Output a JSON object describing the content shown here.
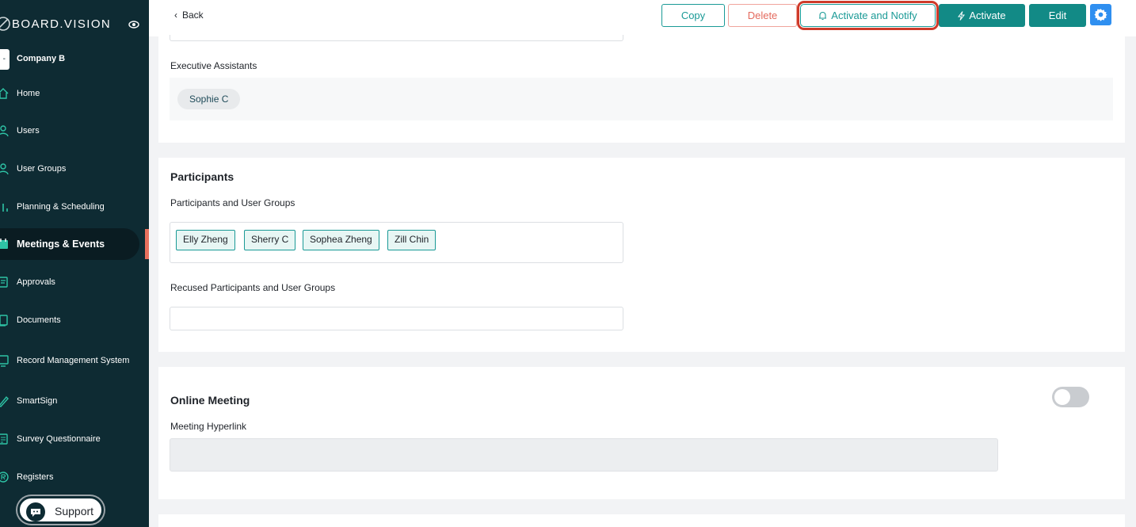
{
  "sidebar": {
    "brand": "BOARD.VISION",
    "company_badge": "-",
    "company": "Company B",
    "items": [
      {
        "label": "Home",
        "icon": "home-icon"
      },
      {
        "label": "Users",
        "icon": "user-icon"
      },
      {
        "label": "User Groups",
        "icon": "user-group-icon"
      },
      {
        "label": "Planning & Scheduling",
        "icon": "chart-icon"
      },
      {
        "label": "Meetings & Events",
        "icon": "calendar-icon"
      },
      {
        "label": "Approvals",
        "icon": "approval-icon"
      },
      {
        "label": "Documents",
        "icon": "documents-icon"
      },
      {
        "label": "Record Management System",
        "icon": "record-icon"
      },
      {
        "label": "SmartSign",
        "icon": "pen-icon"
      },
      {
        "label": "Survey Questionnaire",
        "icon": "survey-icon"
      },
      {
        "label": "Registers",
        "icon": "registers-icon"
      }
    ],
    "active_item": "Meetings & Events",
    "support_label": "Support"
  },
  "topbar": {
    "back_label": "Back",
    "copy_label": "Copy",
    "delete_label": "Delete",
    "notify_label": "Activate and Notify",
    "activate_label": "Activate",
    "edit_label": "Edit"
  },
  "executive_assistants": {
    "label": "Executive Assistants",
    "people": [
      "Sophie C"
    ]
  },
  "participants": {
    "title": "Participants",
    "groups_label": "Participants and User Groups",
    "tags": [
      "Elly Zheng",
      "Sherry C",
      "Sophea Zheng",
      "Zill Chin"
    ],
    "recused_label": "Recused Participants and User Groups",
    "recused_value": ""
  },
  "online_meeting": {
    "title": "Online Meeting",
    "enabled": false,
    "hyperlink_label": "Meeting Hyperlink",
    "hyperlink_value": ""
  },
  "colors": {
    "sidebar_bg": "#0e2b33",
    "accent": "#128a86",
    "danger": "#e46a5e",
    "highlight": "#cf3a2a",
    "gear_bg": "#2f8ff0"
  }
}
